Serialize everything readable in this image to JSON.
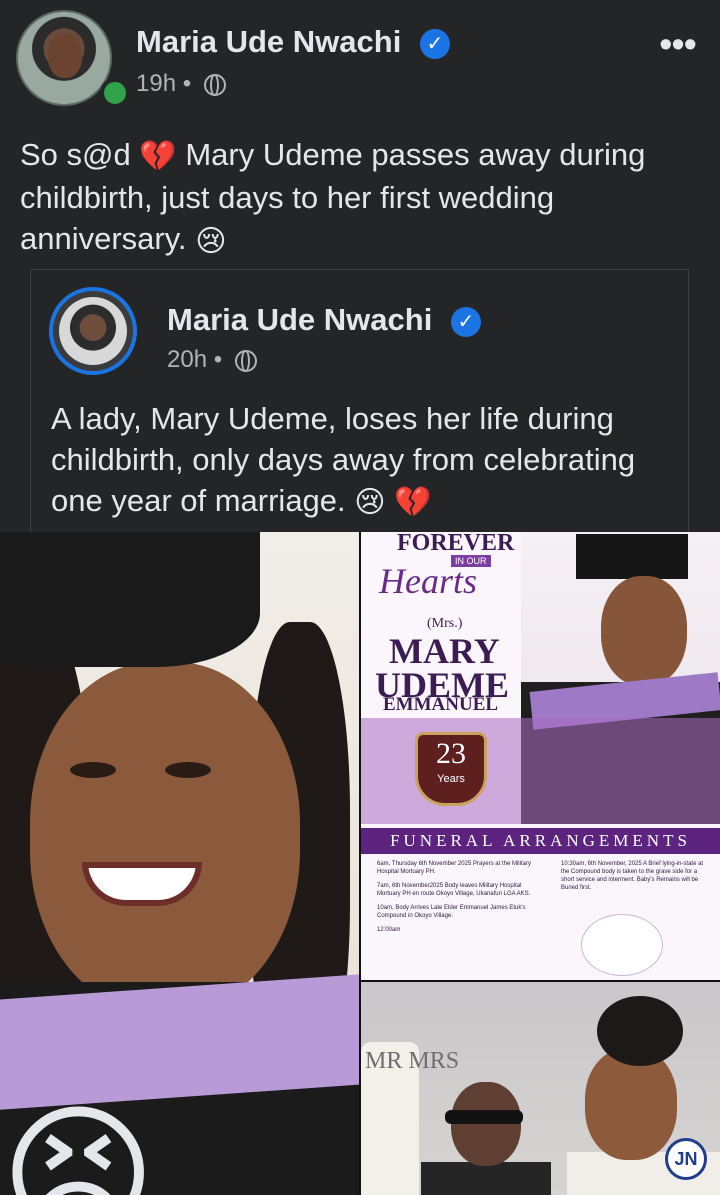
{
  "post": {
    "author_name": "Maria Ude Nwachi",
    "time": "19h",
    "separator": "•",
    "text_part1": "So s@d",
    "emoji_broken_heart": "💔",
    "text_part2": "Mary Udeme passes away during childbirth, just days to her first wedding anniversary.",
    "emoji_sad": "😢",
    "more_label": "•••"
  },
  "shared_post": {
    "author_name": "Maria Ude Nwachi",
    "time": "20h",
    "separator": "•",
    "text": "A lady, Mary Udeme, loses her life during childbirth, only days away from celebrating one year of marriage.",
    "emoji_sad": "😢",
    "emoji_broken_heart": "💔"
  },
  "flyer": {
    "title": "FOREVER",
    "sub": "IN OUR",
    "hearts": "Hearts",
    "mrs": "(Mrs.)",
    "name_line1": "MARY",
    "name_line2": "UDEME",
    "name_line3": "EMMANUEL",
    "age": "23",
    "age_label": "Years",
    "arrangements_title": "FUNERAL ARRANGEMENTS",
    "left_items": [
      "6am, Thursday 6th November 2025 Prayers at the Military Hospital Mortuary PH.",
      "7am, 6th November2025 Body leaves Military Hospital Mortuary PH en route Okoyo Village, Ukanafun LGA AKS.",
      "10am, Body Arrives Late Elder Emmanuel James Etuk's Compound in Okoyo Village.",
      "12:00am"
    ],
    "right_items": [
      "10:30am, 6th November, 2025 A Brief lying-in-state at the Compound body is taken to the grave side for a short service and interment. Baby's Remains will be Buried first."
    ]
  },
  "wedding_photo": {
    "cake_text": "MR MRS",
    "watermark": "JN"
  },
  "icons": {
    "verified": "verified-badge-icon",
    "globe": "globe-icon",
    "more": "more-icon",
    "online": "online-status-icon",
    "bottom_emoji": "sad-face-icon"
  },
  "colors": {
    "background": "#242526",
    "text": "#e4e6eb",
    "secondary": "#b0b3b8",
    "accent": "#1b74e4",
    "online": "#31a24c"
  }
}
